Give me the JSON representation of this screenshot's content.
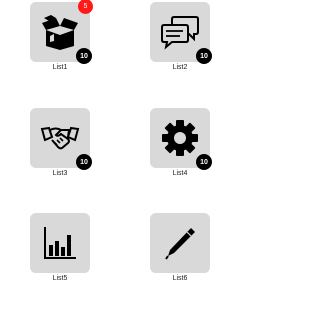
{
  "colors": {
    "tile_bg": "#d9d9d9",
    "badge_bg": "#000000",
    "notification_bg": "#ff1a1a",
    "icon": "#000000"
  },
  "tiles": [
    {
      "label": "List1",
      "icon": "open-box-icon",
      "count": "10",
      "notification": "5"
    },
    {
      "label": "List2",
      "icon": "chat-bubbles-icon",
      "count": "10"
    },
    {
      "label": "List3",
      "icon": "handshake-icon",
      "count": "10"
    },
    {
      "label": "List4",
      "icon": "gear-icon",
      "count": "10"
    },
    {
      "label": "List5",
      "icon": "bar-chart-icon"
    },
    {
      "label": "List6",
      "icon": "pen-icon"
    }
  ]
}
